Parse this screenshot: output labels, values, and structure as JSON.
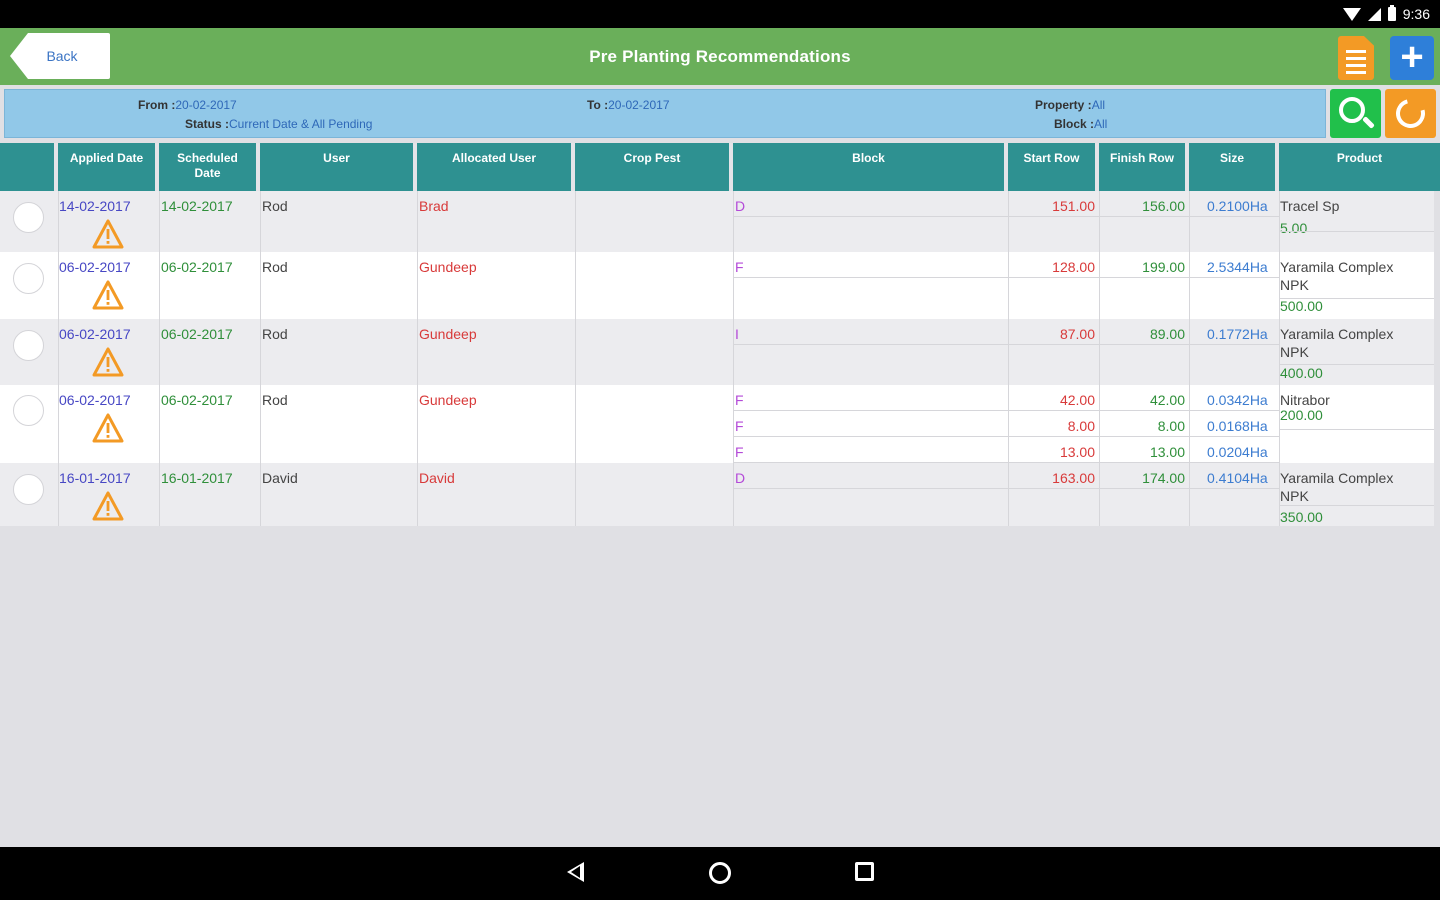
{
  "status_bar": {
    "time": "9:36",
    "icons": [
      "wifi-icon",
      "signal-icon",
      "battery-icon"
    ]
  },
  "app_bar": {
    "back_label": "Back",
    "title": "Pre Planting Recommendations",
    "icons": [
      "document-icon",
      "plus-icon"
    ]
  },
  "filters": {
    "from_label": "From :",
    "from_value": "20-02-2017",
    "to_label": "To :",
    "to_value": "20-02-2017",
    "status_label": "Status :",
    "status_value": "Current Date & All Pending",
    "property_label": "Property :",
    "property_value": "All",
    "block_label": "Block :",
    "block_value": "All",
    "icons": [
      "search-icon",
      "refresh-icon"
    ]
  },
  "table": {
    "headers": {
      "select": "",
      "applied_date": "Applied Date",
      "scheduled_date_line1": "Scheduled",
      "scheduled_date_line2": "Date",
      "user": "User",
      "allocated_user": "Allocated User",
      "crop_pest": "Crop Pest",
      "block": "Block",
      "start_row": "Start Row",
      "finish_row": "Finish Row",
      "size": "Size",
      "product": "Product"
    },
    "rows": [
      {
        "applied_date": "14-02-2017",
        "scheduled_date": "14-02-2017",
        "user": "Rod",
        "allocated_user": "Brad",
        "crop_pest": "",
        "blocks": [
          {
            "block": "D",
            "start_row": "151.00",
            "finish_row": "156.00",
            "size": "0.2100Ha"
          }
        ],
        "products": [
          {
            "name_line1": "Tracel Sp",
            "name_line2": "",
            "qty": "5.00"
          }
        ]
      },
      {
        "applied_date": "06-02-2017",
        "scheduled_date": "06-02-2017",
        "user": "Rod",
        "allocated_user": "Gundeep",
        "crop_pest": "",
        "blocks": [
          {
            "block": "F",
            "start_row": "128.00",
            "finish_row": "199.00",
            "size": "2.5344Ha"
          }
        ],
        "products": [
          {
            "name_line1": "Yaramila Complex",
            "name_line2": "NPK",
            "qty": "500.00"
          }
        ]
      },
      {
        "applied_date": "06-02-2017",
        "scheduled_date": "06-02-2017",
        "user": "Rod",
        "allocated_user": "Gundeep",
        "crop_pest": "",
        "blocks": [
          {
            "block": "I",
            "start_row": "87.00",
            "finish_row": "89.00",
            "size": "0.1772Ha"
          }
        ],
        "products": [
          {
            "name_line1": "Yaramila Complex",
            "name_line2": "NPK",
            "qty": "400.00"
          }
        ]
      },
      {
        "applied_date": "06-02-2017",
        "scheduled_date": "06-02-2017",
        "user": "Rod",
        "allocated_user": "Gundeep",
        "crop_pest": "",
        "blocks": [
          {
            "block": "F",
            "start_row": "42.00",
            "finish_row": "42.00",
            "size": "0.0342Ha"
          },
          {
            "block": "F",
            "start_row": "8.00",
            "finish_row": "8.00",
            "size": "0.0168Ha"
          },
          {
            "block": "F",
            "start_row": "13.00",
            "finish_row": "13.00",
            "size": "0.0204Ha"
          }
        ],
        "products": [
          {
            "name_line1": "Nitrabor",
            "name_line2": "",
            "qty": "200.00"
          }
        ]
      },
      {
        "applied_date": "16-01-2017",
        "scheduled_date": "16-01-2017",
        "user": "David",
        "allocated_user": "David",
        "crop_pest": "",
        "blocks": [
          {
            "block": "D",
            "start_row": "163.00",
            "finish_row": "174.00",
            "size": "0.4104Ha"
          }
        ],
        "products": [
          {
            "name_line1": "Yaramila Complex",
            "name_line2": "NPK",
            "qty": "350.00"
          }
        ]
      }
    ],
    "row_icons": [
      "radio-button-icon",
      "warning-icon"
    ]
  },
  "nav_bar": {
    "icons": [
      "nav-back-icon",
      "nav-home-icon",
      "nav-recent-apps-icon"
    ]
  },
  "colors": {
    "app_bar": "#6aaf5a",
    "table_header": "#2e9191",
    "filter_bar": "#91c8e8",
    "search_button": "#21c04b",
    "refresh_button": "#f39a25",
    "add_button": "#2e7fd9",
    "warning": "#f39a25"
  }
}
